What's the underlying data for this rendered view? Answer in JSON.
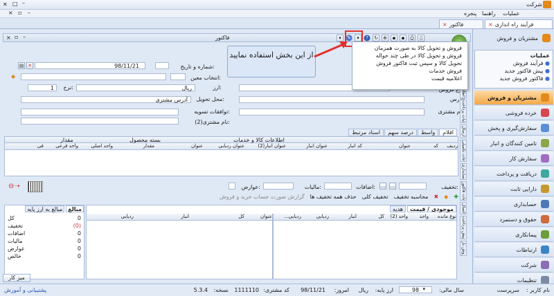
{
  "window": {
    "title": "شرکت"
  },
  "menu": {
    "items": [
      "عملیات",
      "راهنما",
      "پنجره"
    ]
  },
  "doc_tabs": [
    {
      "label": "فرآیند راه اندازی"
    },
    {
      "label": "فاکتور"
    }
  ],
  "form": {
    "title": "فاکتور",
    "number_date_label": "شماره و تاریخ:",
    "date_value": "98/11/21",
    "select_label": "انتخاب معین:",
    "currency_label": "ارز:",
    "currency_value": "ریال",
    "rate_label": "نرخ:",
    "rate_value": "1",
    "sale_type_label": "نوع فروش:",
    "delivery_label": "محل تحویل:",
    "address_value": "آدرس مشتری",
    "address_label": "آدرس:",
    "settlement_label": "توافقات تسویه:",
    "customer_label": "نام مشتری:",
    "customer2_label": "نام مشتری(2):"
  },
  "item_tabs": [
    "اقلام",
    "واسط",
    "درصد سهم",
    "اسناد مرتبط"
  ],
  "grid": {
    "group_products": "اطلاعات کالا و خدمات",
    "group_package": "بسته محصول",
    "group_amount": "مقدار",
    "columns": [
      "ردیف",
      "کد",
      "عنوان",
      "کد انبار",
      "عنوان انبار",
      "عنوان انبار(2)",
      "عنوان ردیابی",
      "عنوان",
      "مقدار",
      "واحد اصلی",
      "واحد فرعی",
      "فی"
    ]
  },
  "totals": {
    "discount_label": "تخفیف:",
    "additions_label": "اضافات:",
    "tax_label": "مالیات:",
    "duties_label": "عوارض:",
    "calc_discount": "محاسبه تخفیف",
    "total_discount": "تخفیف کلی",
    "remove_discount": "حذف همه تخفیف ها",
    "report": "گزارش صورت حساب خرید و فروش"
  },
  "vertical_tabs": [
    "اطلاعات اصلی",
    "جزئیات پرداخت",
    "ارسال",
    "اطلاعات تکمیلی",
    "حسابداری",
    "اطلاعات فاکتور",
    "اتصال",
    "فروش پیش پرداخت",
    "فروش باز"
  ],
  "stock": {
    "tab_stock": "موجودی / قیمت",
    "tab_gift": "هدیه",
    "columns_right": [
      "نوع مانده",
      "واحد",
      "واحد (2)",
      "کل",
      "انبار",
      "ردیابی",
      "ردیابی..."
    ],
    "columns_middle": [
      "عنوان",
      "کل",
      "انبار",
      "ردیابی"
    ]
  },
  "amounts": {
    "tab_amounts": "مبالغ",
    "tab_base": "مبالغ به ارز پایه",
    "rows": [
      {
        "label": "کل",
        "value": "0"
      },
      {
        "label": "تخفیف",
        "value": "(0)"
      },
      {
        "label": "اضافات",
        "value": "0"
      },
      {
        "label": "مالیات",
        "value": "0"
      },
      {
        "label": "عوارض",
        "value": "0"
      },
      {
        "label": "خالص",
        "value": "0"
      }
    ]
  },
  "desktop": "میز کار",
  "popup": {
    "items": [
      "فروش و تحویل کالا به صورت همزمان",
      "فروش و تحویل کالا در طی چند حواله",
      "تحویل کالا و سپس ثبت فاکتور فروش",
      "فروش خدمات",
      "اعلامیه قیمت"
    ]
  },
  "callout": {
    "text": "از این بخش استفاده نمایید"
  },
  "nav": {
    "header": "مشتریان و فروش",
    "ops_title": "عملیات",
    "ops_items": [
      "فرآیند فروش",
      "پیش فاکتور جدید",
      "فاکتور فروش جدید"
    ],
    "buttons": [
      {
        "label": "مشتریان و فروش",
        "color": "#e38a1a"
      },
      {
        "label": "خرده فروشی",
        "color": "#d8474d"
      },
      {
        "label": "سفارش‌گیری و پخش",
        "color": "#5a8fd6"
      },
      {
        "label": "تامین کنندگان و انبار",
        "color": "#8aa84a"
      },
      {
        "label": "سفارش کار",
        "color": "#a36bc2"
      },
      {
        "label": "دریافت و پرداخت",
        "color": "#3da7a0"
      },
      {
        "label": "دارایی ثابت",
        "color": "#c49a30"
      },
      {
        "label": "حسابداری",
        "color": "#4d78b8"
      },
      {
        "label": "حقوق و دستمزد",
        "color": "#cf6a3c"
      },
      {
        "label": "پیمانکاری",
        "color": "#6a9e3b"
      },
      {
        "label": "ارتباطات",
        "color": "#3b86c7"
      },
      {
        "label": "شرکت",
        "color": "#8a6fb5"
      },
      {
        "label": "تنظیمات",
        "color": "#7c8aa3"
      }
    ]
  },
  "status": {
    "user_label": "نام کاربر :",
    "user_value": "سرپرست",
    "year_label": "سال مالی:",
    "year_value": "98",
    "base_label": "ارز پایه:",
    "base_value": "ریال",
    "today_label": "امروز:",
    "today_value": "98/11/21",
    "code_label": "کد مشتری:",
    "code_value": "1111110",
    "version_label": "نسخه:",
    "version_value": "5.3.4",
    "support": "پشتیبانی و آموزش"
  },
  "colors": {
    "accent": "#e38a1a",
    "highlight": "#e0322d",
    "nav_bg": "#dbe5f3"
  }
}
